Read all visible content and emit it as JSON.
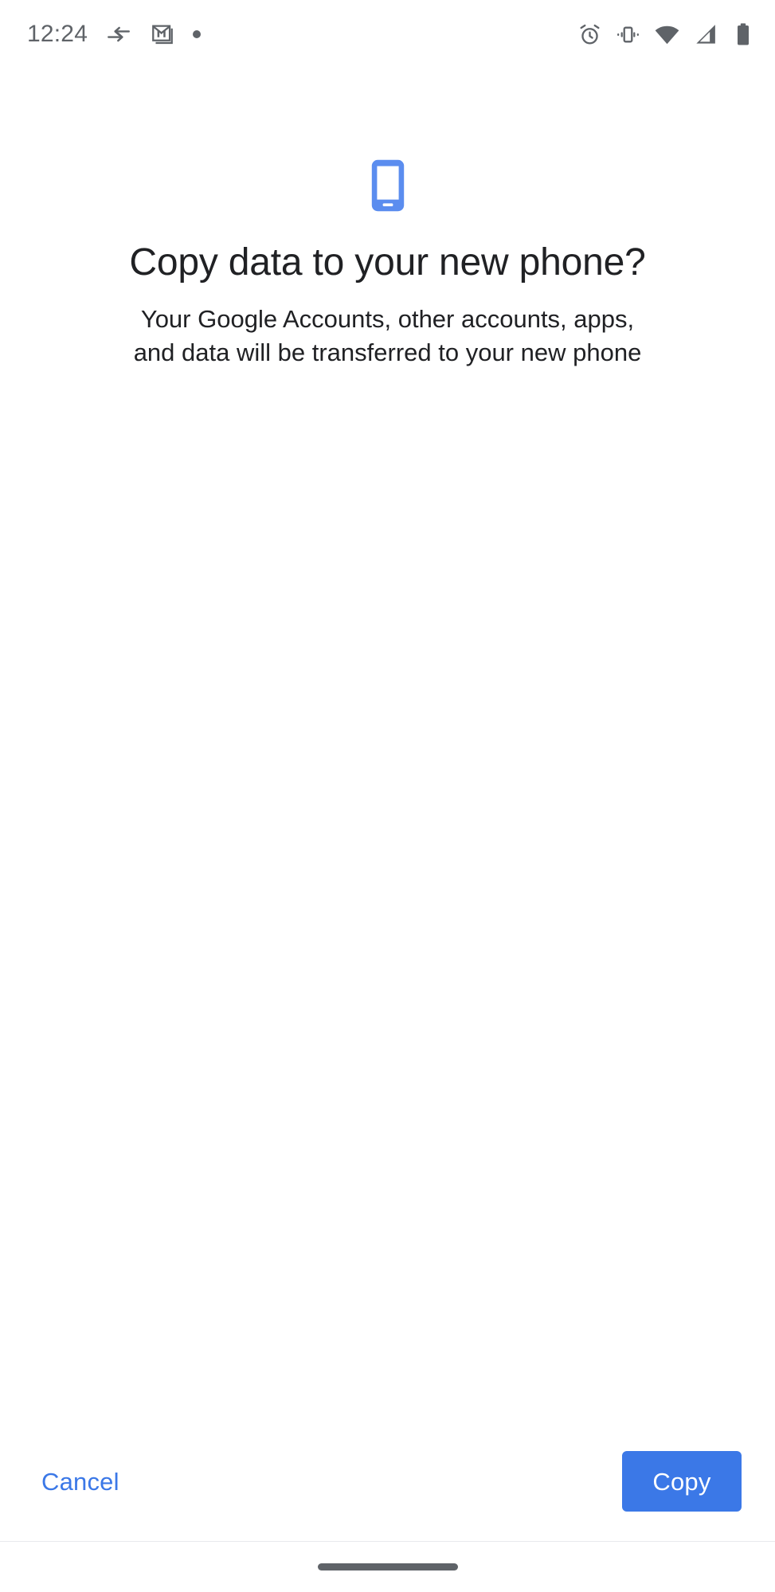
{
  "status_bar": {
    "clock": "12:24",
    "left_icons": [
      {
        "name": "data-transfer-icon",
        "label": "Data transfer"
      },
      {
        "name": "gmail-icon",
        "label": "Gmail notification"
      },
      {
        "name": "notification-dot-icon",
        "label": "More notifications"
      }
    ],
    "right_icons": [
      {
        "name": "alarm-icon",
        "label": "Alarm set"
      },
      {
        "name": "vibrate-icon",
        "label": "Ringer vibrate"
      },
      {
        "name": "wifi-icon",
        "label": "Wi-Fi full signal"
      },
      {
        "name": "cell-signal-icon",
        "label": "Mobile signal"
      },
      {
        "name": "battery-icon",
        "label": "Battery full"
      }
    ]
  },
  "hero": {
    "icon": "smartphone-icon",
    "icon_color": "#5b8def"
  },
  "main": {
    "title": "Copy data to your new phone?",
    "subtitle": "Your Google Accounts, other accounts, apps, and data will be transferred to your new phone"
  },
  "actions": {
    "cancel_label": "Cancel",
    "copy_label": "Copy",
    "accent_color": "#3b78e7",
    "text_button_color": "#3b78e7"
  },
  "navigation": {
    "gesture_pill": "home-gesture-pill",
    "pill_color": "#5f6368"
  }
}
